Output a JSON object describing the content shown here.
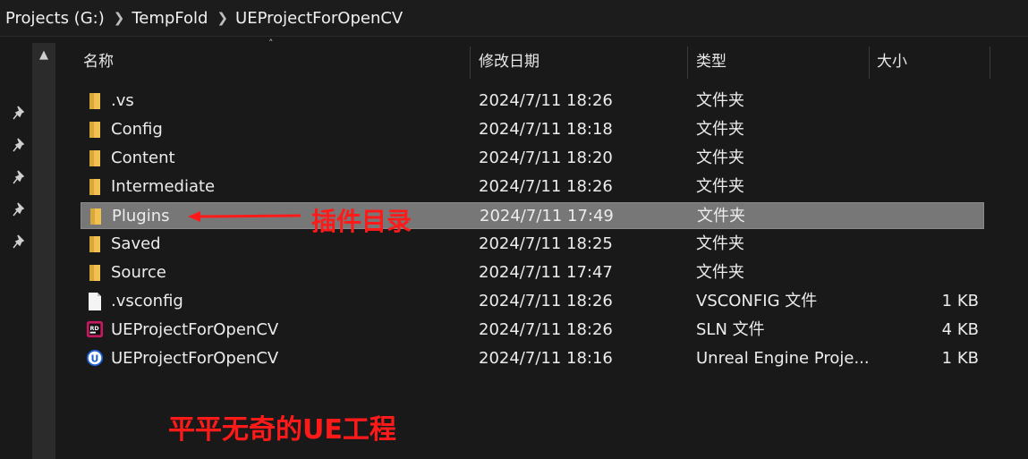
{
  "breadcrumb": [
    "Projects (G:)",
    "TempFold",
    "UEProjectForOpenCV"
  ],
  "columns": {
    "name": "名称",
    "date": "修改日期",
    "type": "类型",
    "size": "大小"
  },
  "files": [
    {
      "name": ".vs",
      "date": "2024/7/11 18:26",
      "type": "文件夹",
      "size": "",
      "icon": "folder-icon"
    },
    {
      "name": "Config",
      "date": "2024/7/11 18:18",
      "type": "文件夹",
      "size": "",
      "icon": "folder-icon"
    },
    {
      "name": "Content",
      "date": "2024/7/11 18:20",
      "type": "文件夹",
      "size": "",
      "icon": "folder-icon"
    },
    {
      "name": "Intermediate",
      "date": "2024/7/11 18:26",
      "type": "文件夹",
      "size": "",
      "icon": "folder-icon"
    },
    {
      "name": "Plugins",
      "date": "2024/7/11 17:49",
      "type": "文件夹",
      "size": "",
      "icon": "folder-icon",
      "selected": true
    },
    {
      "name": "Saved",
      "date": "2024/7/11 18:25",
      "type": "文件夹",
      "size": "",
      "icon": "folder-icon"
    },
    {
      "name": "Source",
      "date": "2024/7/11 17:47",
      "type": "文件夹",
      "size": "",
      "icon": "folder-icon"
    },
    {
      "name": ".vsconfig",
      "date": "2024/7/11 18:26",
      "type": "VSCONFIG 文件",
      "size": "1 KB",
      "icon": "file-icon"
    },
    {
      "name": "UEProjectForOpenCV",
      "date": "2024/7/11 18:26",
      "type": "SLN 文件",
      "size": "4 KB",
      "icon": "rider-sln-icon"
    },
    {
      "name": "UEProjectForOpenCV",
      "date": "2024/7/11 18:16",
      "type": "Unreal Engine Proje...",
      "size": "1 KB",
      "icon": "unreal-engine-icon"
    }
  ],
  "annotations": {
    "plugins_label": "插件目录",
    "footer_label": "平平无奇的UE工程"
  },
  "colors": {
    "background": "#191919",
    "selected_row": "#777777",
    "annotation": "#ff1a1a",
    "folder": "#f0c050"
  },
  "icons": {
    "nav_pin": "pin-icon",
    "scroll_up": "chevron-up-icon",
    "breadcrumb_separator": "chevron-right-icon"
  }
}
